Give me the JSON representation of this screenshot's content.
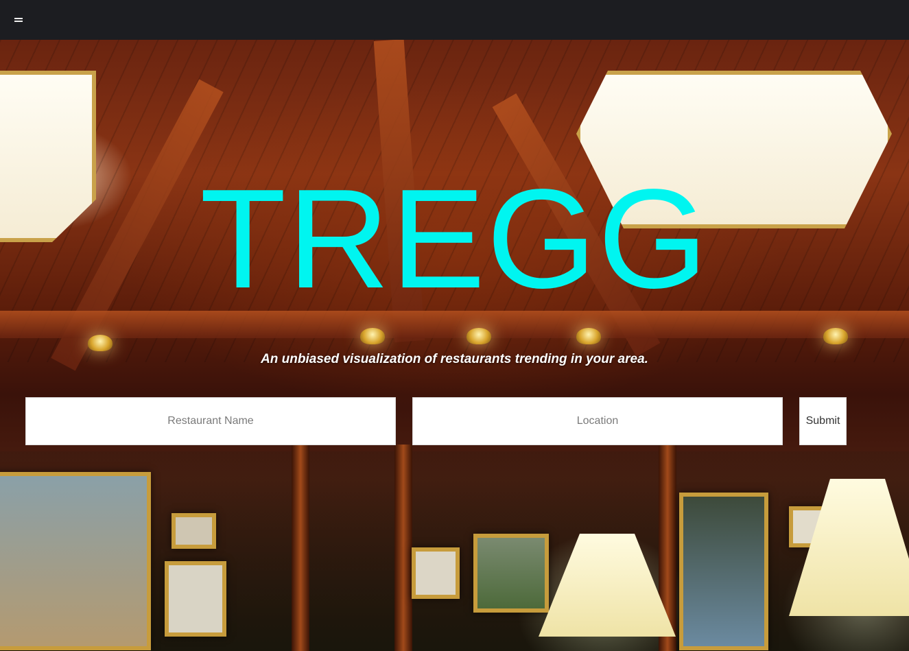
{
  "nav": {
    "menu_icon": "hamburger-menu-icon"
  },
  "hero": {
    "title": "TREGG",
    "tagline": "An unbiased visualization of restaurants trending in your area."
  },
  "search": {
    "restaurant_placeholder": "Restaurant Name",
    "restaurant_value": "",
    "location_placeholder": "Location",
    "location_value": "",
    "submit_label": "Submit"
  },
  "colors": {
    "title": "#00f5f0",
    "topbar": "#1c1d21",
    "tagline": "#ffffff"
  }
}
